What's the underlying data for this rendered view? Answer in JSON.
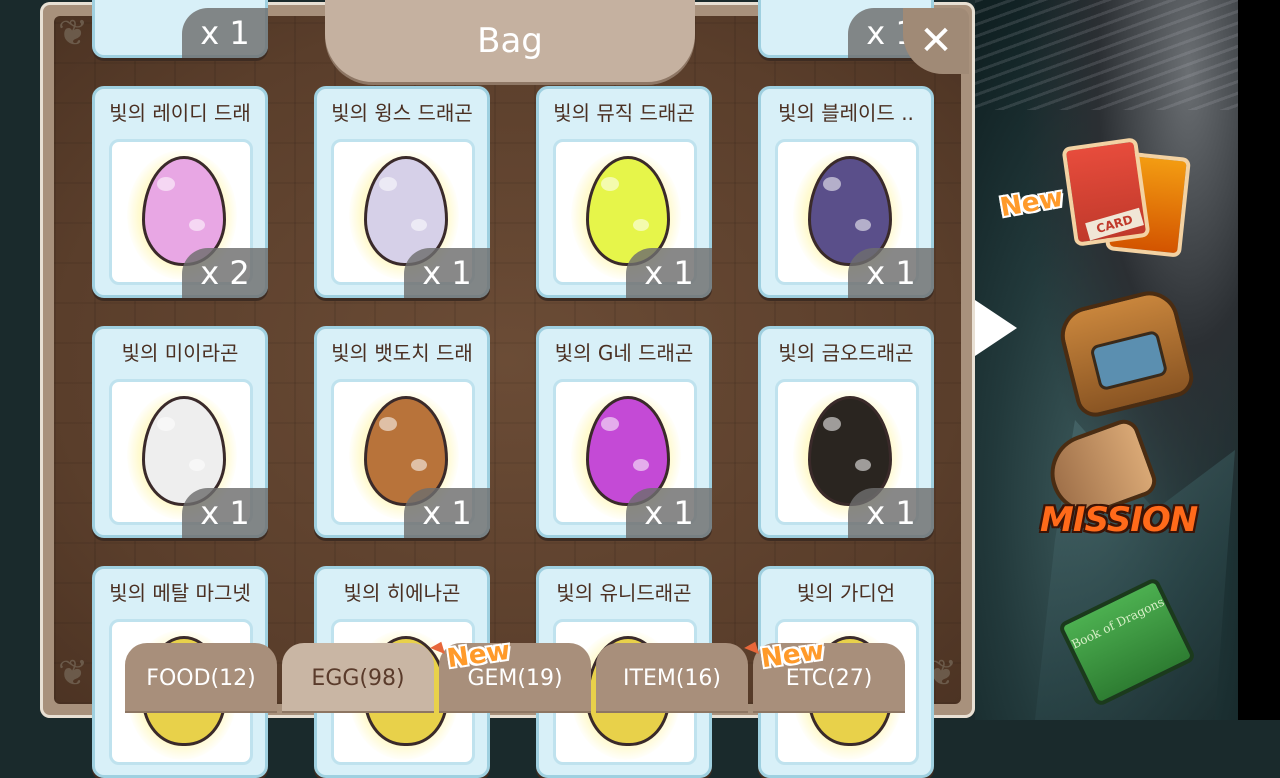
{
  "window": {
    "title": "Bag",
    "close_icon": "close-icon"
  },
  "colors": {
    "panel": "#a8917c",
    "card_bg": "#d8f0f8",
    "count_badge": "#6e6e6e",
    "new_badge": "#ff9a2a",
    "active_tab": "#c9b6a4"
  },
  "top_partial_counts": [
    "x 1",
    "x 1"
  ],
  "items": [
    {
      "name": "빛의 레이디 드래",
      "count": "x 2",
      "egg_color": "#e8a7e4"
    },
    {
      "name": "빛의 윙스 드래곤",
      "count": "x 1",
      "egg_color": "#d6d0e8"
    },
    {
      "name": "빛의 뮤직 드래곤",
      "count": "x 1",
      "egg_color": "#e6f54a"
    },
    {
      "name": "빛의 블레이드 ..",
      "count": "x 1",
      "egg_color": "#5a4f8a"
    },
    {
      "name": "빛의 미이라곤",
      "count": "x 1",
      "egg_color": "#eeeeee"
    },
    {
      "name": "빛의 뱃도치 드래",
      "count": "x 1",
      "egg_color": "#b8733a"
    },
    {
      "name": "빛의 G네 드래곤",
      "count": "x 1",
      "egg_color": "#c44ad6"
    },
    {
      "name": "빛의 금오드래곤",
      "count": "x 1",
      "egg_color": "#2a2520"
    },
    {
      "name": "빛의 메탈 마그넷",
      "count": "",
      "egg_color": "#e8d14a"
    },
    {
      "name": "빛의 히에나곤",
      "count": "",
      "egg_color": "#e8d14a"
    },
    {
      "name": "빛의 유니드래곤",
      "count": "",
      "egg_color": "#e8d14a"
    },
    {
      "name": "빛의 가디언",
      "count": "",
      "egg_color": "#e8d14a"
    }
  ],
  "tabs": [
    {
      "label": "FOOD(12)",
      "active": false,
      "new": false
    },
    {
      "label": "EGG(98)",
      "active": true,
      "new": false
    },
    {
      "label": "GEM(19)",
      "active": false,
      "new": true
    },
    {
      "label": "ITEM(16)",
      "active": false,
      "new": false
    },
    {
      "label": "ETC(27)",
      "active": false,
      "new": true
    }
  ],
  "new_label": "New",
  "side_menu": {
    "card_label": "CARD",
    "card_new": "New",
    "mission_label": "MISSION",
    "book_label": "Book of Dragons"
  }
}
